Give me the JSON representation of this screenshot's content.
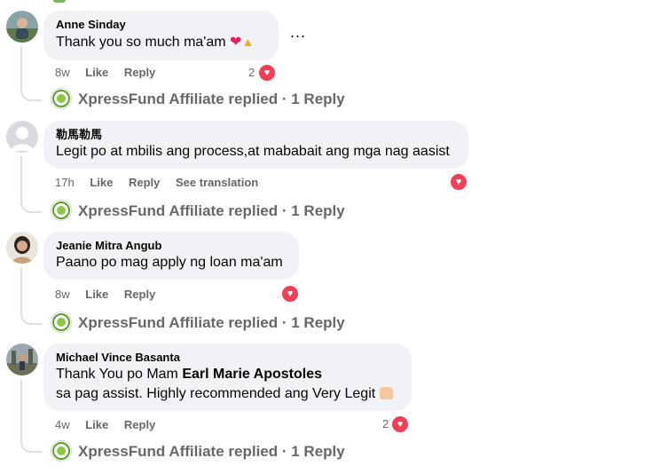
{
  "comments": [
    {
      "author": "Anne Sinday",
      "text": "Thank you so much ma'am",
      "time": "8w",
      "like_label": "Like",
      "reply_label": "Reply",
      "reaction_count": "2",
      "replied_by": "XpressFund Affiliate replied",
      "reply_count": "1 Reply",
      "more_icon": "ellipsis-icon",
      "more_label": "..."
    },
    {
      "author": "勒馬勒馬",
      "text": "Legit po at mbilis ang process,at mababait ang mga nag aasist",
      "time": "17h",
      "like_label": "Like",
      "reply_label": "Reply",
      "translation_label": "See translation",
      "replied_by": "XpressFund Affiliate replied",
      "reply_count": "1 Reply"
    },
    {
      "author": "Jeanie Mitra Angub",
      "text": "Paano po mag apply ng loan ma'am",
      "time": "8w",
      "like_label": "Like",
      "reply_label": "Reply",
      "replied_by": "XpressFund Affiliate replied",
      "reply_count": "1 Reply"
    },
    {
      "author": "Michael Vince Basanta",
      "text_line1_prefix": "Thank You po Mam ",
      "text_line1_mention": "Earl Marie Apostoles",
      "text_line2": "sa pag assist. Highly recommended ang Very Legit",
      "time": "4w",
      "like_label": "Like",
      "reply_label": "Reply",
      "reaction_count": "2",
      "replied_by": "XpressFund Affiliate replied",
      "reply_count": "1 Reply"
    }
  ],
  "separator": " · ",
  "colors": {
    "bubble": "#f0f2f5",
    "meta_text": "#65676b",
    "heart": "#f33e58",
    "brand_green": "#5aa02c"
  }
}
